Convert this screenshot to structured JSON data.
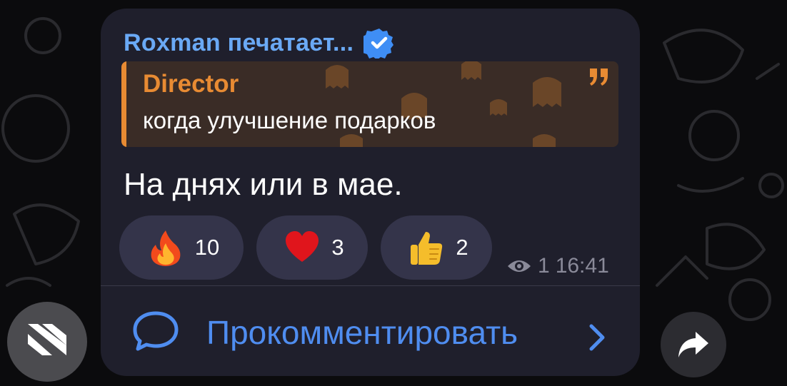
{
  "post": {
    "sender_status": "Roxman печатает...",
    "reply_quote": {
      "author": "Director",
      "text": "когда улучшение подарков"
    },
    "message_text": "На днях или в мае.",
    "reactions": [
      {
        "emoji": "fire",
        "count": "10"
      },
      {
        "emoji": "heart",
        "count": "3"
      },
      {
        "emoji": "thumbs-up",
        "count": "2"
      }
    ],
    "views": "1",
    "time": "16:41",
    "comment_label": "Прокомментировать"
  },
  "icons": [
    "verified-badge-icon",
    "quote-mark-icon",
    "eye-icon",
    "comment-bubble-icon",
    "chevron-right-icon",
    "share-arrow-icon",
    "channel-logo-icon"
  ],
  "colors": {
    "background": "#0b0b0d",
    "bubble": "#1f1f2c",
    "sender_name": "#6aa9f5",
    "quote_accent": "#e88b33",
    "quote_background": "#3a2c26",
    "reaction_pill": "#34344a",
    "link_blue": "#4f8df0",
    "meta_gray": "#8a8a99"
  }
}
